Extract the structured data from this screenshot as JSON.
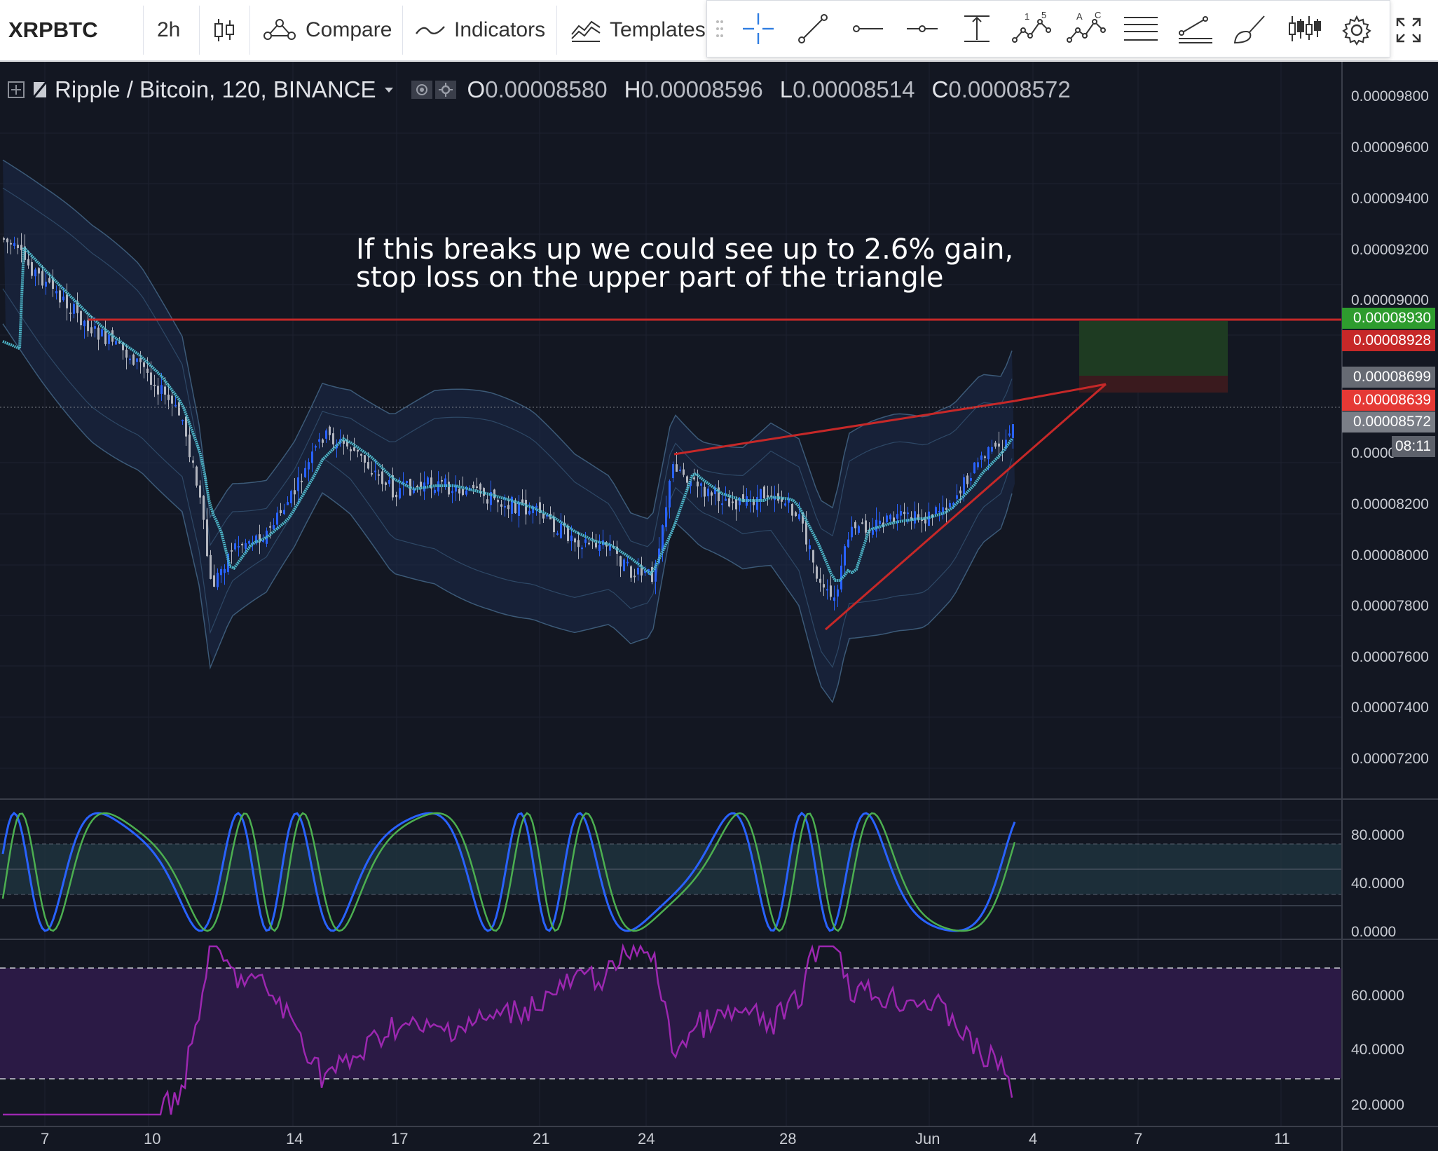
{
  "toolbar": {
    "symbol": "XRPBTC",
    "interval": "2h",
    "compare_label": "Compare",
    "indicators_label": "Indicators",
    "templates_label": "Templates",
    "tool_labels": {
      "elliott_a": "1",
      "elliott_b": "5",
      "abcd_a": "A",
      "abcd_b": "C"
    }
  },
  "legend": {
    "symbol_title": "Ripple / Bitcoin, 120, BINANCE",
    "open_label": "O",
    "open_value": "0.00008580",
    "high_label": "H",
    "high_value": "0.00008596",
    "low_label": "L",
    "low_value": "0.00008514",
    "close_label": "C",
    "close_value": "0.00008572"
  },
  "annotation": "If this breaks up we could see up to 2.6% gain,\nstop loss on the upper part of the triangle",
  "price_axis": {
    "labels": [
      "0.00009800",
      "0.00009600",
      "0.00009400",
      "0.00009200",
      "0.00009000",
      "0.00008200",
      "0.00008000",
      "0.00007800",
      "0.00007600",
      "0.00007400",
      "0.00007200"
    ],
    "partial_label": "0.0000"
  },
  "price_tags": [
    {
      "value": "0.00008930",
      "color": "#2e9c2e"
    },
    {
      "value": "0.00008928",
      "color": "#c62828"
    },
    {
      "value": "0.00008699",
      "color": "#666a73"
    },
    {
      "value": "0.00008639",
      "color": "#e53935"
    },
    {
      "value": "0.00008572",
      "color": "#7a7e87"
    }
  ],
  "countdown": "08:11",
  "stoch_axis": [
    "80.0000",
    "40.0000",
    "0.0000"
  ],
  "rsi_axis": [
    "60.0000",
    "40.0000",
    "20.0000"
  ],
  "date_labels": [
    "7",
    "10",
    "14",
    "17",
    "21",
    "24",
    "28",
    "Jun",
    "4",
    "7",
    "11"
  ],
  "colors": {
    "background": "#131722",
    "candle_up": "#2962ff",
    "candle_down": "#b2b5be",
    "moving_average": "#4db6c8",
    "trend_lines": "#c62828",
    "target_zone": "#1e3b22",
    "stop_zone": "#3a1a1e",
    "stoch_k": "#2962ff",
    "stoch_d": "#4caf50",
    "rsi_line": "#9c27b0",
    "rsi_band": "#2b1a45"
  }
}
